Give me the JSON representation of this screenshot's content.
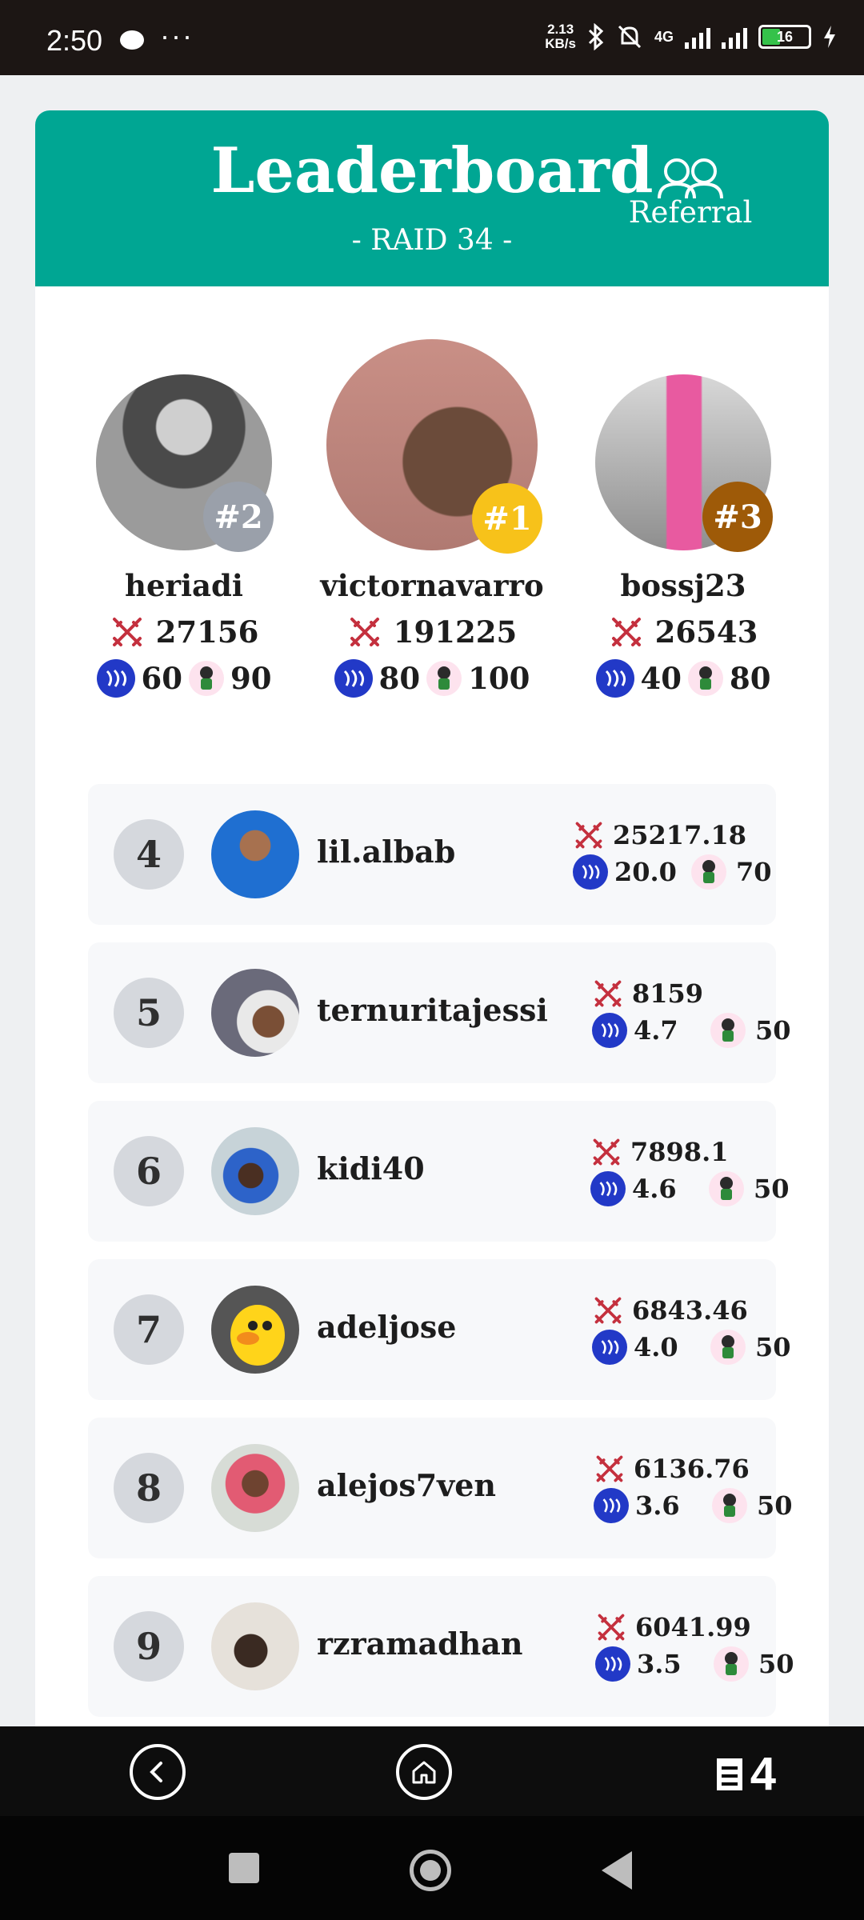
{
  "status_bar": {
    "time": "2:50",
    "more": "···",
    "net_speed_value": "2.13",
    "net_speed_unit": "KB/s",
    "network": "4G",
    "battery": "16"
  },
  "header": {
    "title": "Leaderboard",
    "subtitle": "- RAID 34 -",
    "referral_label": "Referral",
    "color": "#00a693"
  },
  "podium": [
    {
      "rank_label": "#2",
      "name": "heriadi",
      "score": "27156",
      "steem": "60",
      "mascot": "90",
      "badge_color": "#9aa0aa"
    },
    {
      "rank_label": "#1",
      "name": "victornavarro",
      "score": "191225",
      "steem": "80",
      "mascot": "100",
      "badge_color": "#f7c21a"
    },
    {
      "rank_label": "#3",
      "name": "bossj23",
      "score": "26543",
      "steem": "40",
      "mascot": "80",
      "badge_color": "#9e5a08"
    }
  ],
  "rows": [
    {
      "rank": "4",
      "name": "lil.albab",
      "score": "25217.18",
      "steem": "20.0",
      "mascot": "70"
    },
    {
      "rank": "5",
      "name": "ternuritajessi",
      "score": "8159",
      "steem": "4.7",
      "mascot": "50"
    },
    {
      "rank": "6",
      "name": "kidi40",
      "score": "7898.1",
      "steem": "4.6",
      "mascot": "50"
    },
    {
      "rank": "7",
      "name": "adeljose",
      "score": "6843.46",
      "steem": "4.0",
      "mascot": "50"
    },
    {
      "rank": "8",
      "name": "alejos7ven",
      "score": "6136.76",
      "steem": "3.6",
      "mascot": "50"
    },
    {
      "rank": "9",
      "name": "rzramadhan",
      "score": "6041.99",
      "steem": "3.5",
      "mascot": "50"
    }
  ],
  "nav": {
    "tab_count": "4"
  },
  "icons": {
    "score": "crossed-swords-icon",
    "steem": "steem-icon",
    "mascot": "mascot-icon",
    "referral": "users-icon",
    "back": "back-icon",
    "home": "home-icon",
    "tabs": "tabs-icon"
  }
}
